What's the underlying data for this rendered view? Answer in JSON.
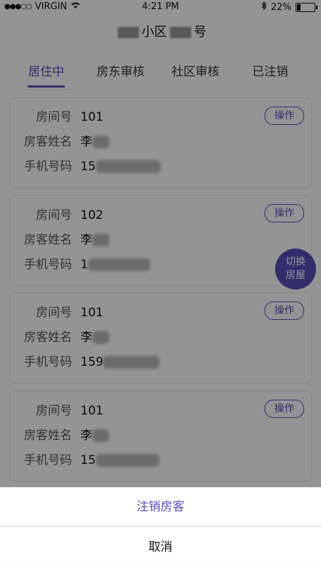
{
  "status_bar": {
    "signal_dots": "●●●○○",
    "carrier": "VIRGIN",
    "wifi_icon": "wifi-icon",
    "time": "4:21 PM",
    "bluetooth_icon": "bluetooth-icon",
    "battery_percent": "22%",
    "battery_level": 0.22
  },
  "header": {
    "title_part1": "小区",
    "title_part2": "号"
  },
  "tabs": [
    {
      "label": "居住中",
      "active": true
    },
    {
      "label": "房东审核",
      "active": false
    },
    {
      "label": "社区审核",
      "active": false
    },
    {
      "label": "已注销",
      "active": false
    }
  ],
  "labels": {
    "room": "房间号",
    "name": "房客姓名",
    "phone": "手机号码",
    "operate": "操作"
  },
  "residents": [
    {
      "room": "101",
      "name_visible": "李",
      "phone_visible": "15"
    },
    {
      "room": "102",
      "name_visible": "李",
      "phone_visible": "1"
    },
    {
      "room": "101",
      "name_visible": "李",
      "phone_visible": "159"
    },
    {
      "room": "101",
      "name_visible": "李",
      "phone_visible": "15"
    }
  ],
  "fab": {
    "line1": "切换",
    "line2": "房屋"
  },
  "action_sheet": {
    "primary": "注销房客",
    "cancel": "取消"
  },
  "colors": {
    "accent": "#5a4fb8",
    "overlay": "rgba(0,0,0,0.42)"
  }
}
